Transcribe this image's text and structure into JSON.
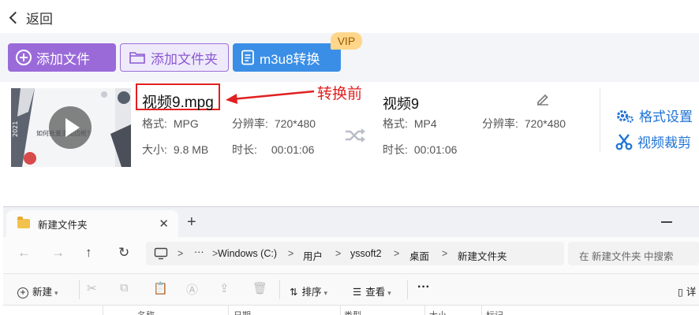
{
  "app": {
    "back_label": "返回",
    "buttons": {
      "add_file": "添加文件",
      "add_folder": "添加文件夹",
      "m3u8": "m3u8转换",
      "vip_badge": "VIP"
    },
    "thumbnail": {
      "caption": "如何批量添加边框？",
      "year": "2021"
    },
    "source": {
      "name": "视频9.mpg",
      "format_label": "格式:",
      "format": "MPG",
      "resolution_label": "分辨率:",
      "resolution": "720*480",
      "size_label": "大小:",
      "size": "9.8 MB",
      "duration_label": "时长:",
      "duration": "00:01:06"
    },
    "annotation": "转换前",
    "output": {
      "name": "视频9",
      "format_label": "格式:",
      "format": "MP4",
      "resolution_label": "分辨率:",
      "resolution": "720*480",
      "duration_label": "时长:",
      "duration": "00:01:06"
    },
    "side": {
      "format_settings": "格式设置",
      "video_crop": "视频裁剪"
    },
    "colors": {
      "purple": "#9a6ad9",
      "blue": "#3a8ee6",
      "red_annotation": "#e02020",
      "link_blue": "#1e73d6"
    }
  },
  "explorer": {
    "tab_title": "新建文件夹",
    "tab_close": "✕",
    "tab_add": "+",
    "nav": {
      "back": "←",
      "forward": "→",
      "up": "↑",
      "refresh": "↻"
    },
    "address": {
      "more": "···",
      "crumbs": [
        "Windows (C:)",
        "用户",
        "yssoft2",
        "桌面",
        "新建文件夹"
      ],
      "separator": ">"
    },
    "search_placeholder": "在 新建文件夹 中搜索",
    "commands": {
      "new": "新建",
      "sort": "排序",
      "view": "查看",
      "more": "···",
      "details": "详"
    },
    "columns": [
      "名称",
      "日期",
      "类型",
      "大小",
      "标记"
    ]
  }
}
